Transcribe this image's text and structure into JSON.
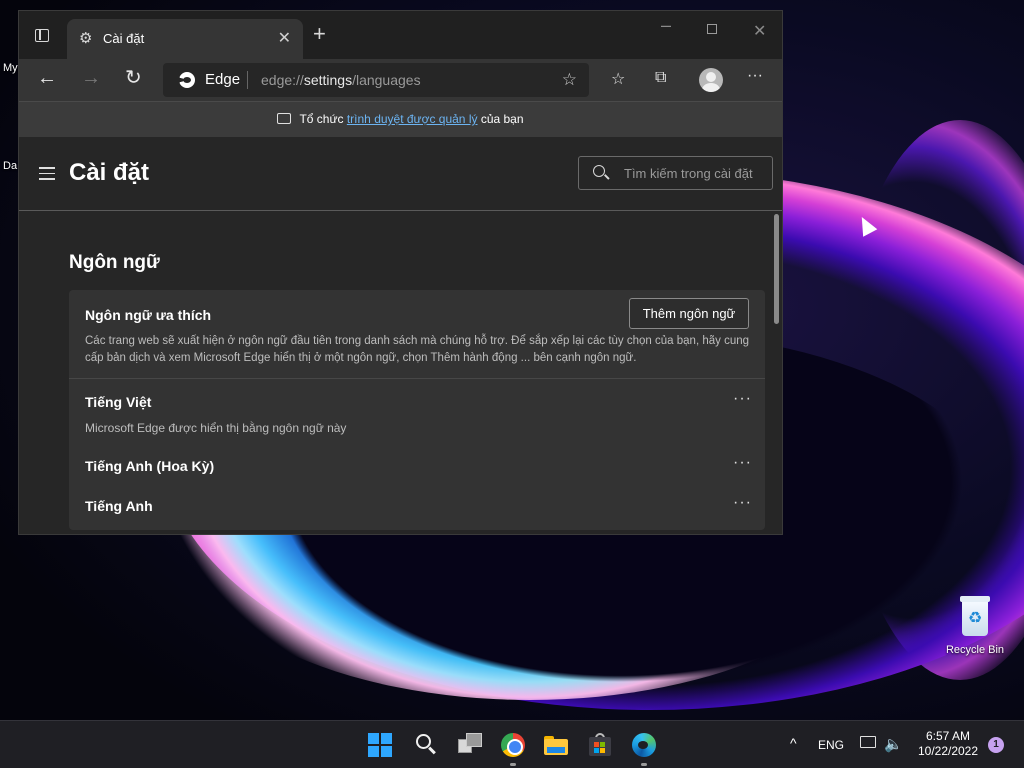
{
  "desktop": {
    "partial_label_1": "My",
    "partial_label_2": "Da",
    "recycle_bin_label": "Recycle Bin"
  },
  "browser": {
    "tab_title": "Cài đặt",
    "new_tab_symbol": "+",
    "address_brand": "Edge",
    "url_prefix": "edge://",
    "url_host": "settings",
    "url_path": "/languages",
    "managed_banner": {
      "prefix": "Tổ chức ",
      "link": "trình duyệt được quản lý",
      "suffix": " của bạn"
    }
  },
  "settings": {
    "title": "Cài đặt",
    "search_placeholder": "Tìm kiếm trong cài đặt",
    "section_title": "Ngôn ngữ",
    "preferred_heading": "Ngôn ngữ ưa thích",
    "add_language_button": "Thêm ngôn ngữ",
    "preferred_description": "Các trang web sẽ xuất hiện ở ngôn ngữ đầu tiên trong danh sách mà chúng hỗ trợ. Để sắp xếp lại các tùy chọn của bạn, hãy cung cấp bản dịch và xem Microsoft Edge hiển thị ở một ngôn ngữ, chọn Thêm hành động ... bên cạnh ngôn ngữ.",
    "languages": [
      {
        "name": "Tiếng Việt",
        "subtitle": "Microsoft Edge được hiển thị bằng ngôn ngữ này"
      },
      {
        "name": "Tiếng Anh (Hoa Kỳ)",
        "subtitle": ""
      },
      {
        "name": "Tiếng Anh",
        "subtitle": ""
      }
    ],
    "more_actions_symbol": "···"
  },
  "taskbar": {
    "apps": [
      "start",
      "search",
      "task-view",
      "chrome",
      "file-explorer",
      "microsoft-store",
      "edge"
    ],
    "tray_chevron": "^",
    "input_language": "ENG",
    "time": "6:57 AM",
    "date": "10/22/2022",
    "notification_count": "1"
  },
  "colors": {
    "accent_link": "#6cb4f2",
    "windows_blue": "#2ea7ff",
    "notification_badge": "#c7a2f0"
  }
}
